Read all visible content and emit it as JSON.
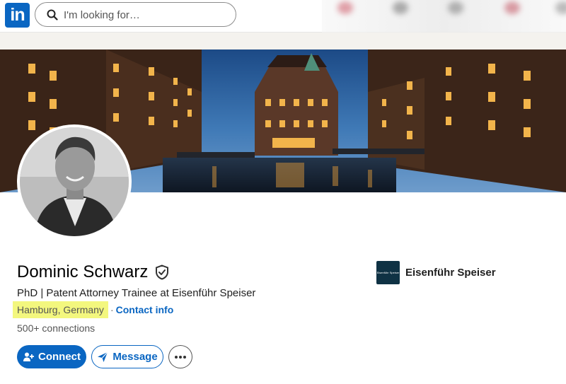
{
  "nav": {
    "logo_text": "in",
    "search_placeholder": "I'm looking for…"
  },
  "profile": {
    "name": "Dominic Schwarz",
    "headline": "PhD | Patent Attorney Trainee at Eisenführ Speiser",
    "location": "Hamburg, Germany",
    "separator": "·",
    "contact_info": "Contact info",
    "connections": "500+ connections",
    "verified_icon": "shield-check-icon"
  },
  "company": {
    "logo_text": "Eisenführ Speiser",
    "name": "Eisenführ Speiser"
  },
  "actions": {
    "connect_label": "Connect",
    "message_label": "Message",
    "more_icon": "ellipsis-icon"
  },
  "colors": {
    "brand_blue": "#0a66c2",
    "location_highlight": "#f3f77e",
    "company_logo_bg": "#0f3244"
  }
}
